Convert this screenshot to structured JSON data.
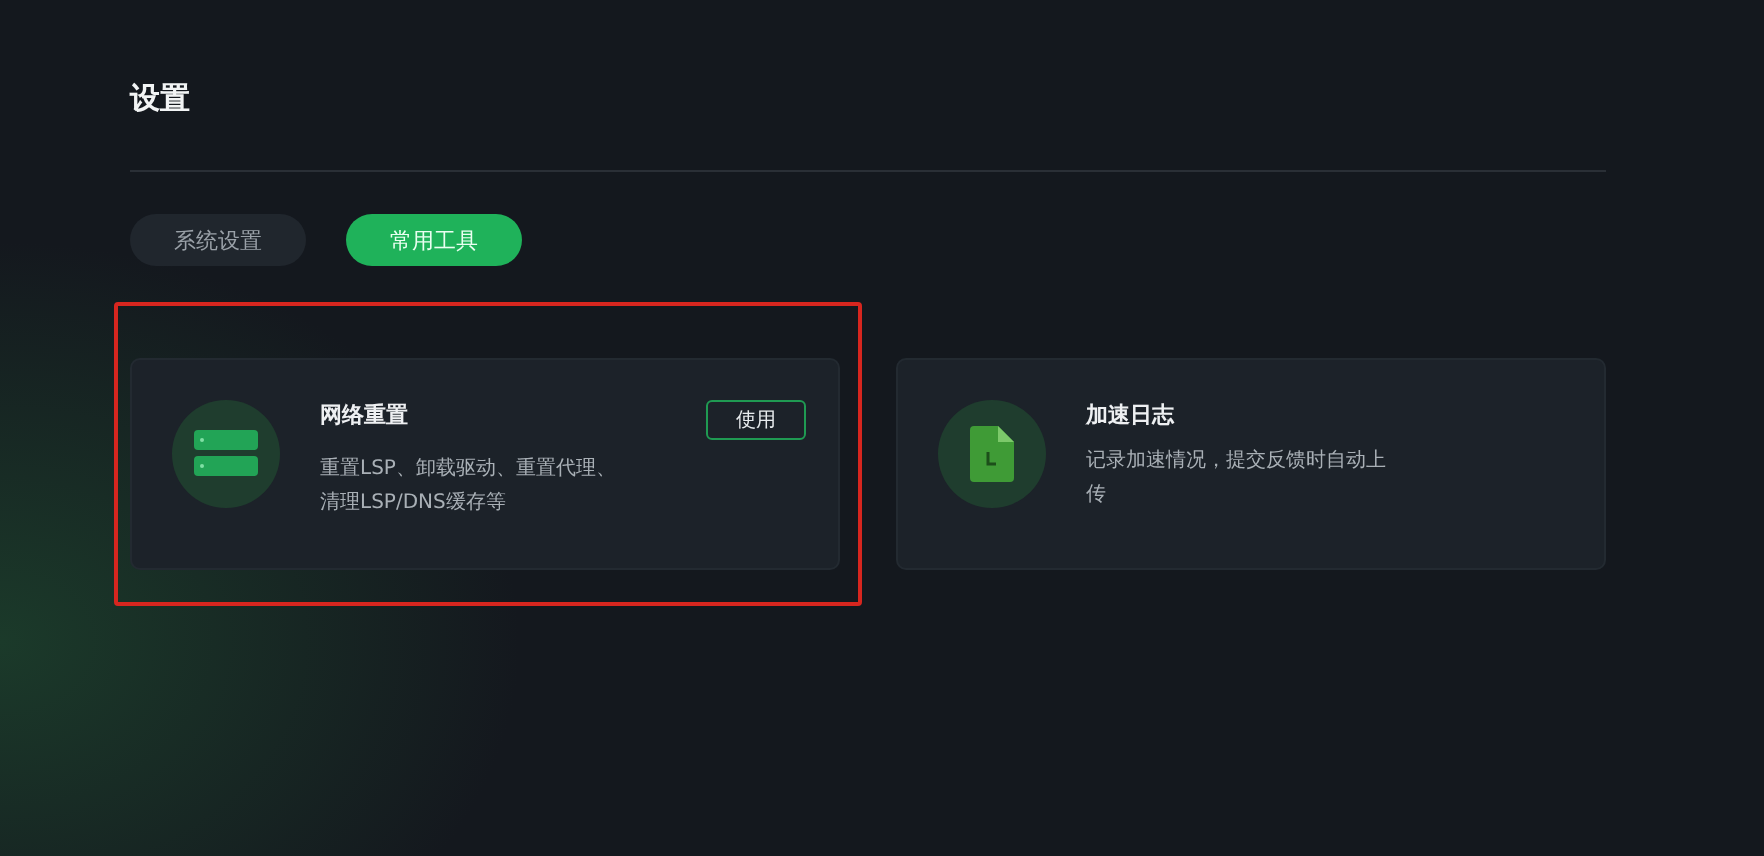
{
  "page": {
    "title": "设置"
  },
  "tabs": [
    {
      "label": "系统设置",
      "selected": false
    },
    {
      "label": "常用工具",
      "selected": true
    }
  ],
  "tools": [
    {
      "kind": "network",
      "name": "网络重置",
      "description": "重置LSP、卸载驱动、重置代理、清理LSP/DNS缓存等",
      "button": "使用",
      "highlighted": true
    },
    {
      "kind": "log",
      "name": "加速日志",
      "description": "记录加速情况，提交反馈时自动上传",
      "highlighted": false
    }
  ]
}
